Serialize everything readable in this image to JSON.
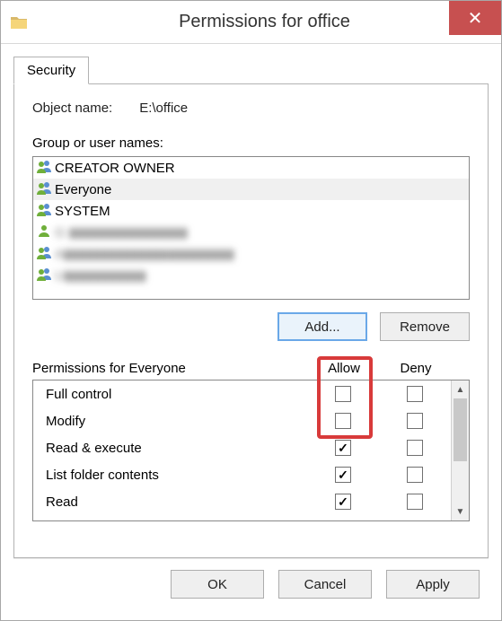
{
  "window": {
    "title": "Permissions for office",
    "close": "✕"
  },
  "tab": {
    "security": "Security"
  },
  "panel": {
    "object_name_label": "Object name:",
    "object_name_value": "E:\\office",
    "group_label": "Group or user names:",
    "users": [
      {
        "name": "CREATOR OWNER",
        "icon": "users",
        "blur": false
      },
      {
        "name": "Everyone",
        "icon": "users",
        "blur": false,
        "selected": true
      },
      {
        "name": "SYSTEM",
        "icon": "users",
        "blur": false
      },
      {
        "name": "G ▮▮▮▮▮▮▮▮▮▮▮▮▮▮▮▮",
        "icon": "user",
        "blur": true
      },
      {
        "name": "A▮▮▮▮▮▮▮▮▮▮▮▮▮▮▮▮▮▮▮▮▮▮▮",
        "icon": "users",
        "blur": true
      },
      {
        "name": "U▮▮▮▮▮▮▮▮▮▮▮",
        "icon": "users",
        "blur": true
      }
    ],
    "add_btn": "Add...",
    "remove_btn": "Remove",
    "perm_for_label": "Permissions for Everyone",
    "col_allow": "Allow",
    "col_deny": "Deny",
    "permissions": [
      {
        "name": "Full control",
        "allow": false,
        "deny": false
      },
      {
        "name": "Modify",
        "allow": false,
        "deny": false
      },
      {
        "name": "Read & execute",
        "allow": true,
        "deny": false
      },
      {
        "name": "List folder contents",
        "allow": true,
        "deny": false
      },
      {
        "name": "Read",
        "allow": true,
        "deny": false
      }
    ]
  },
  "footer": {
    "ok": "OK",
    "cancel": "Cancel",
    "apply": "Apply"
  }
}
